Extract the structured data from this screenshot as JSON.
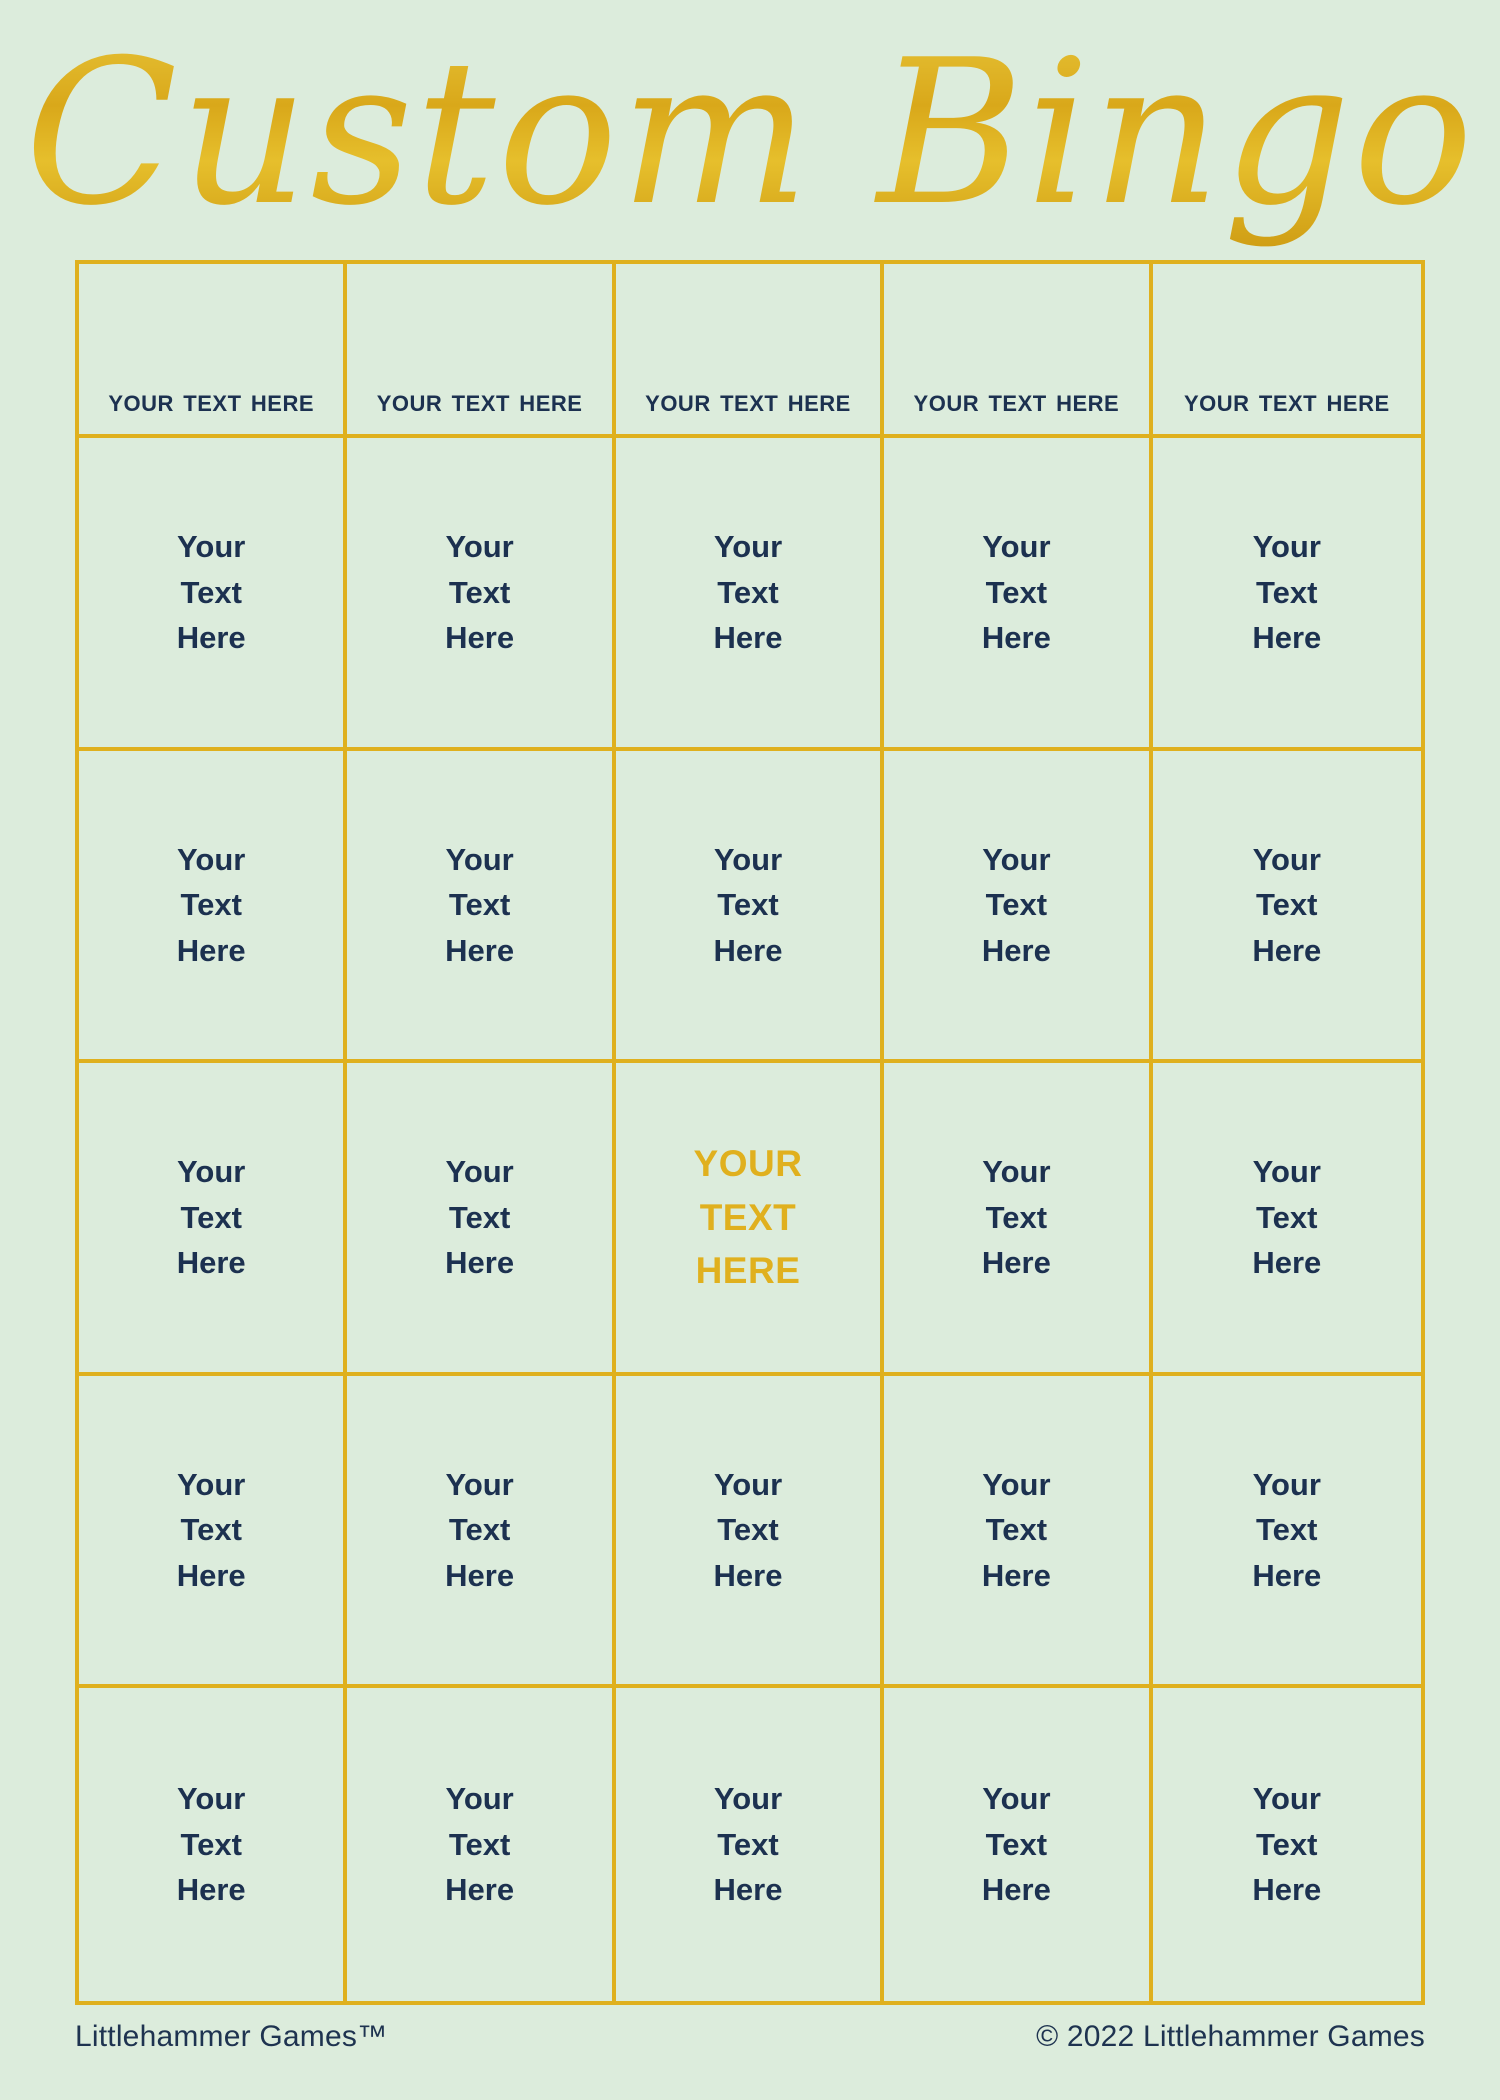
{
  "title": "Custom Bingo",
  "colors": {
    "background": "#dcecdc",
    "gold": "#dfb01e",
    "navy": "#1c3150",
    "free_space_text": "#e0b01e"
  },
  "grid": {
    "columns": 5,
    "rows": 5,
    "headers": [
      "Your Text Here",
      "Your Text Here",
      "Your Text Here",
      "Your Text Here",
      "Your Text Here"
    ],
    "cells": [
      [
        "Your\nText\nHere",
        "Your\nText\nHere",
        "Your\nText\nHere",
        "Your\nText\nHere",
        "Your\nText\nHere"
      ],
      [
        "Your\nText\nHere",
        "Your\nText\nHere",
        "Your\nText\nHere",
        "Your\nText\nHere",
        "Your\nText\nHere"
      ],
      [
        "Your\nText\nHere",
        "Your\nText\nHere",
        "YOUR\nTEXT\nHERE",
        "Your\nText\nHere",
        "Your\nText\nHere"
      ],
      [
        "Your\nText\nHere",
        "Your\nText\nHere",
        "Your\nText\nHere",
        "Your\nText\nHere",
        "Your\nText\nHere"
      ],
      [
        "Your\nText\nHere",
        "Your\nText\nHere",
        "Your\nText\nHere",
        "Your\nText\nHere",
        "Your\nText\nHere"
      ]
    ],
    "free_space": {
      "row": 2,
      "col": 2
    }
  },
  "footer": {
    "left": "Littlehammer Games™",
    "right": "© 2022 Littlehammer Games"
  }
}
